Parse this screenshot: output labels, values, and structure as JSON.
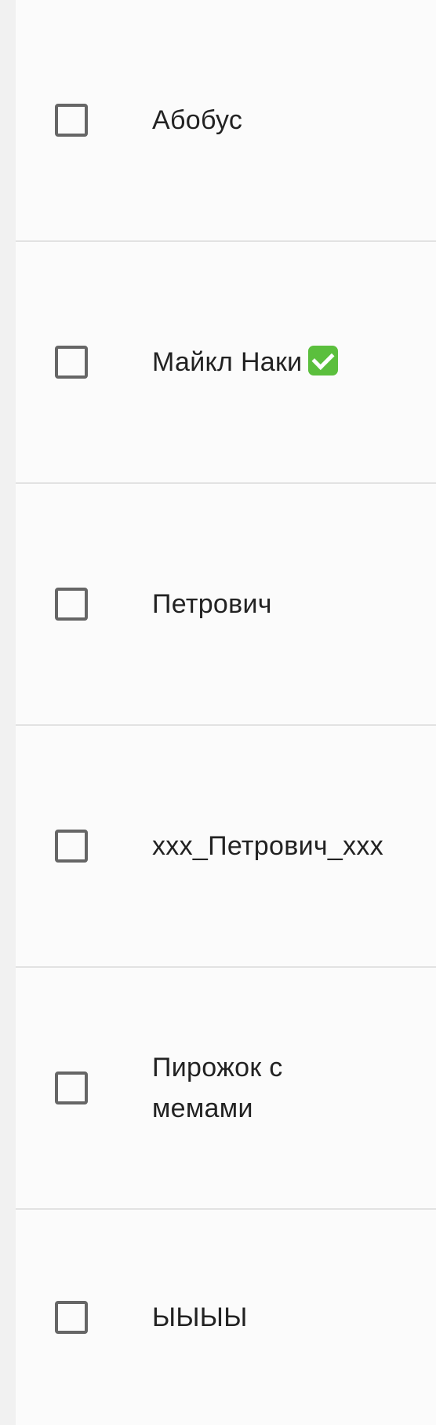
{
  "items": [
    {
      "label": "Абобус",
      "checked": false,
      "badge": ""
    },
    {
      "label": "Майкл Наки",
      "checked": false,
      "badge": "check-mark-icon"
    },
    {
      "label": "Петрович",
      "checked": false,
      "badge": ""
    },
    {
      "label": "xxx_Петрович_xxx",
      "checked": false,
      "badge": ""
    },
    {
      "label": "Пирожок с мемами",
      "checked": false,
      "badge": ""
    },
    {
      "label": "ЫЫЫЫ",
      "checked": false,
      "badge": ""
    }
  ],
  "colors": {
    "checkbox_border": "#666666",
    "text": "#222222",
    "divider": "#e2e2e2",
    "emoji_green": "#5bbf3d"
  }
}
